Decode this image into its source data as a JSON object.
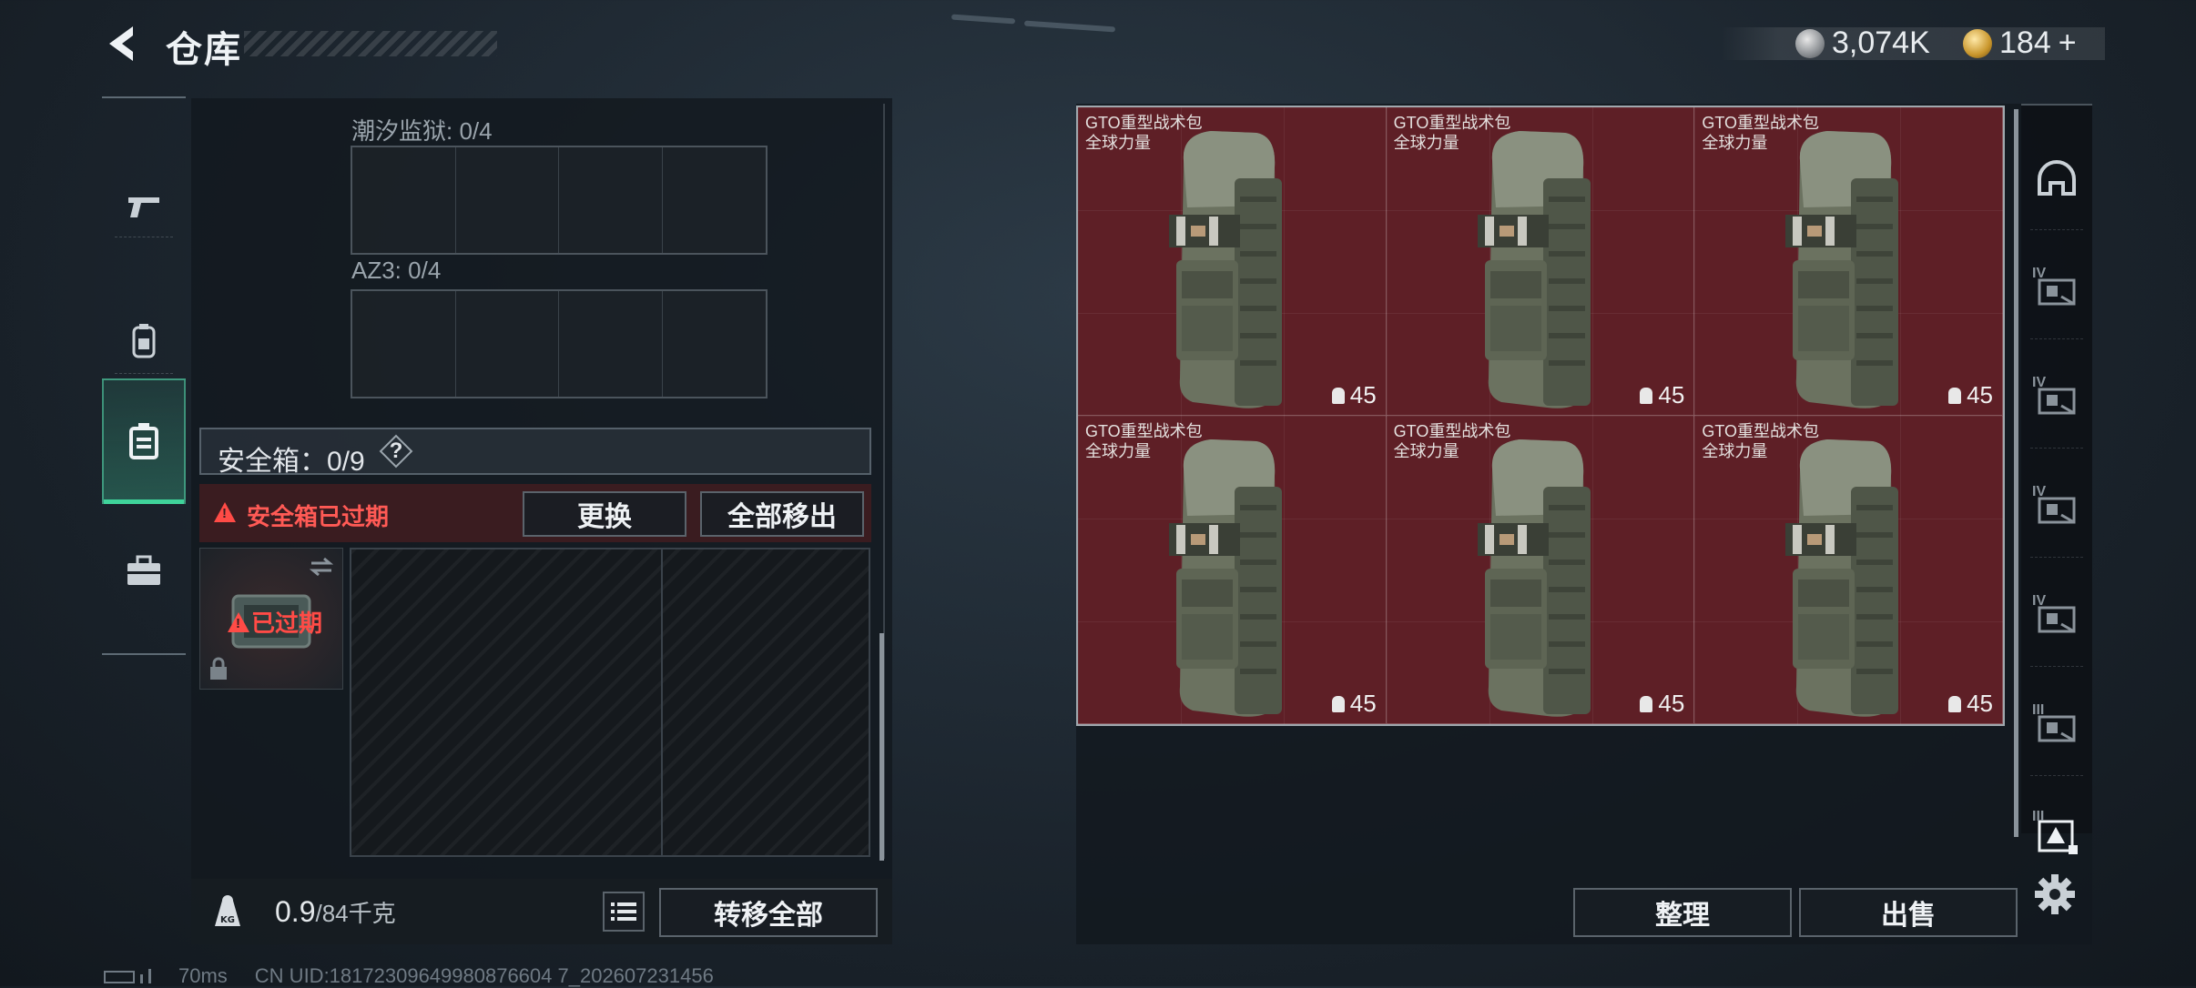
{
  "header": {
    "title": "仓库",
    "currency_silver": "3,074K",
    "currency_gold": "184",
    "currency_gold_add": "+"
  },
  "left_nav": {
    "items": [
      {
        "icon": "pistol-icon"
      },
      {
        "icon": "backpack-icon"
      },
      {
        "icon": "safebox-icon",
        "active": true
      },
      {
        "icon": "toolbox-icon"
      }
    ]
  },
  "loadout": {
    "slot1_label": "潮汐监狱: 0/4",
    "slot2_label": "AZ3: 0/4",
    "safebox_label": "安全箱：0/9",
    "help_symbol": "?",
    "expired_notice": "安全箱已过期",
    "replace_button": "更换",
    "move_all_out_button": "全部移出",
    "thumb_expired": "已过期"
  },
  "bottom_left": {
    "weight_current": "0.9",
    "weight_capacity": "/84千克",
    "transfer_all_button": "转移全部"
  },
  "status_bar": {
    "ping": "70ms",
    "uid": "CN UID:18172309649980876604 7_202607231456"
  },
  "storage": {
    "items": [
      {
        "name": "GTO重型战术包",
        "subtitle": "全球力量",
        "weight": "45"
      },
      {
        "name": "GTO重型战术包",
        "subtitle": "全球力量",
        "weight": "45"
      },
      {
        "name": "GTO重型战术包",
        "subtitle": "全球力量",
        "weight": "45"
      },
      {
        "name": "GTO重型战术包",
        "subtitle": "全球力量",
        "weight": "45"
      },
      {
        "name": "GTO重型战术包",
        "subtitle": "全球力量",
        "weight": "45"
      },
      {
        "name": "GTO重型战术包",
        "subtitle": "全球力量",
        "weight": "45"
      }
    ],
    "sort_button": "整理",
    "sell_button": "出售"
  },
  "right_categories": {
    "items": [
      {
        "icon": "helmet-icon",
        "tier": ""
      },
      {
        "icon": "tier4-armor-icon",
        "tier": "IV"
      },
      {
        "icon": "tier4-rig-icon",
        "tier": "IV"
      },
      {
        "icon": "tier4-rig-icon",
        "tier": "IV"
      },
      {
        "icon": "tier4-rig-icon",
        "tier": "IV"
      },
      {
        "icon": "tier3-armor-icon",
        "tier": "III"
      },
      {
        "icon": "tier3-safebox-icon",
        "tier": "III"
      }
    ]
  },
  "colors": {
    "item_cell_bg": "#5e1f26",
    "expired_red": "#ff4b46",
    "active_green": "#3fd39a"
  }
}
